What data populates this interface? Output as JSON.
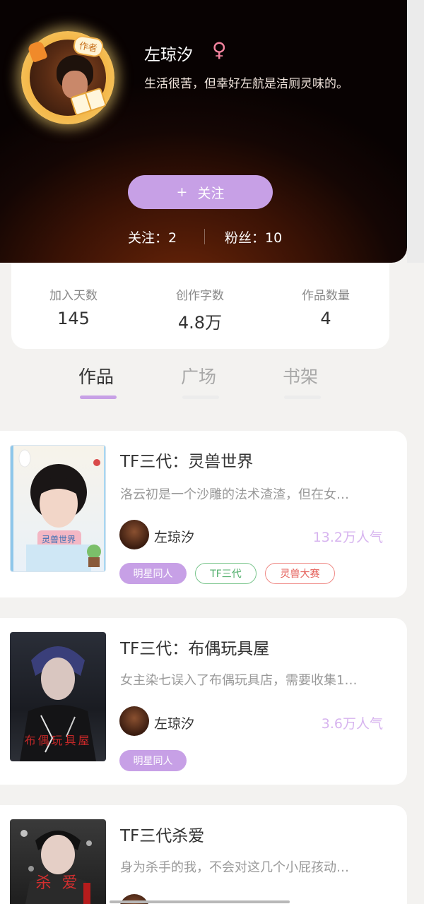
{
  "profile": {
    "name": "左琼汐",
    "gender_symbol": "♀",
    "bio": "生活很苦，但幸好左航是洁厕灵味的。",
    "avatar_badge": "作者",
    "follow_button_plus": "+",
    "follow_button_label": "关注",
    "following_label": "关注：2",
    "fans_label": "粉丝：10"
  },
  "stats": [
    {
      "label": "加入天数",
      "value": "145"
    },
    {
      "label": "创作字数",
      "value": "4.8万"
    },
    {
      "label": "作品数量",
      "value": "4"
    }
  ],
  "tabs": [
    {
      "label": "作品",
      "active": true
    },
    {
      "label": "广场",
      "active": false
    },
    {
      "label": "书架",
      "active": false
    }
  ],
  "colors": {
    "accent_purple": "#c7a0e6",
    "popularity": "#d7b4ef",
    "tag_green": "#4fae6a",
    "tag_red": "#e45e58",
    "gender_pink": "#f3839e"
  },
  "works": [
    {
      "title": "TF三代：灵兽世界",
      "description": "洛云初是一个沙雕的法术渣渣，但在女…",
      "author": "左琼汐",
      "popularity": "13.2万人气",
      "cover_text": "灵兽世界",
      "tags": [
        {
          "label": "明星同人",
          "style": "purple"
        },
        {
          "label": "TF三代",
          "style": "green"
        },
        {
          "label": "灵兽大赛",
          "style": "red"
        }
      ]
    },
    {
      "title": "TF三代：布偶玩具屋",
      "description": "女主染七误入了布偶玩具店，需要收集1…",
      "author": "左琼汐",
      "popularity": "3.6万人气",
      "cover_text": "布偶玩具屋",
      "tags": [
        {
          "label": "明星同人",
          "style": "purple"
        }
      ]
    },
    {
      "title": "TF三代杀爱",
      "description": "身为杀手的我，不会对这几个小屁孩动…",
      "cover_text": "杀 爱"
    }
  ]
}
